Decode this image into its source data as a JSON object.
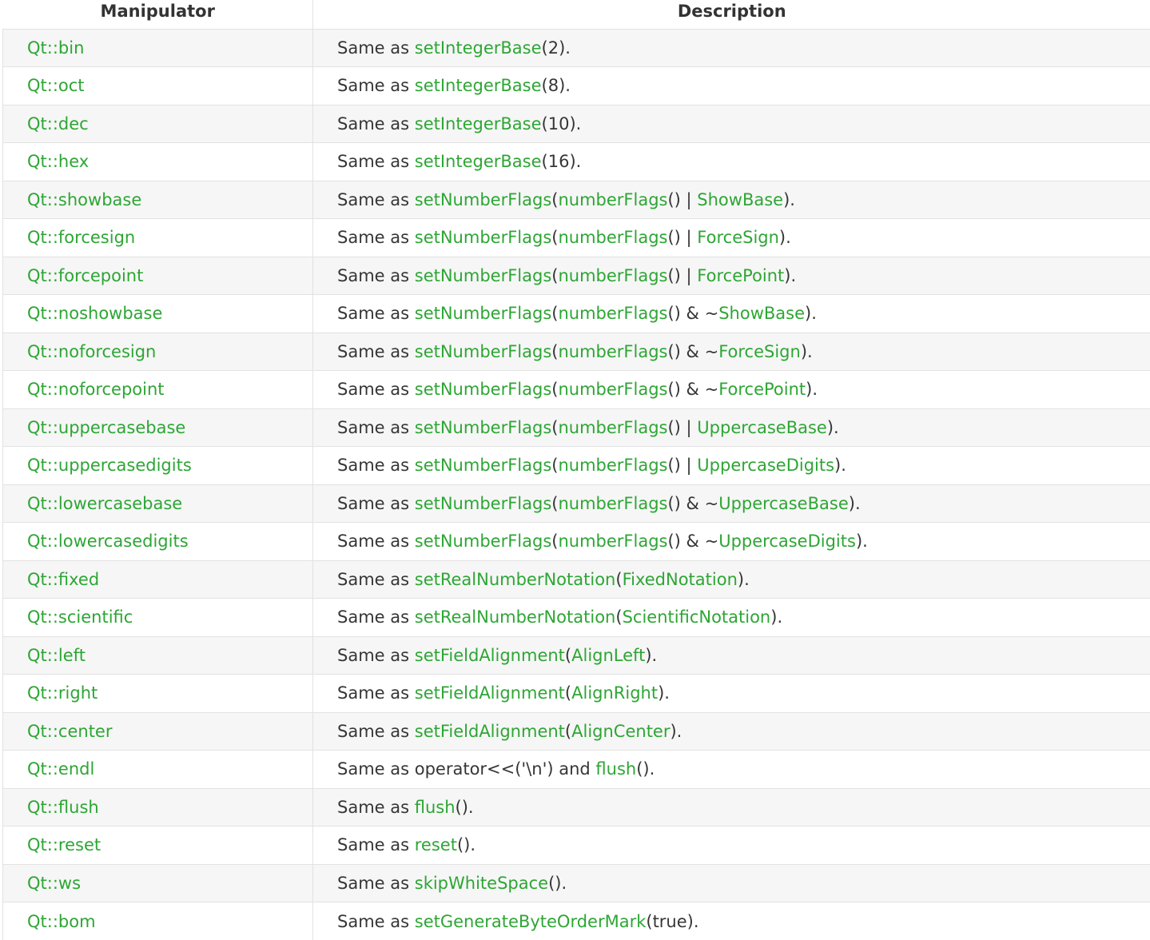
{
  "headers": {
    "col1": "Manipulator",
    "col2": "Description"
  },
  "colors": {
    "link": "#2da634",
    "text": "#363636",
    "stripe": "#f6f6f6"
  },
  "rows": [
    {
      "manipulator": "Qt::bin",
      "desc": [
        [
          "t",
          "Same as "
        ],
        [
          "l",
          "setIntegerBase"
        ],
        [
          "t",
          "(2).",
          "end"
        ]
      ]
    },
    {
      "manipulator": "Qt::oct",
      "desc": [
        [
          "t",
          "Same as "
        ],
        [
          "l",
          "setIntegerBase"
        ],
        [
          "t",
          "(8)."
        ]
      ]
    },
    {
      "manipulator": "Qt::dec",
      "desc": [
        [
          "t",
          "Same as "
        ],
        [
          "l",
          "setIntegerBase"
        ],
        [
          "t",
          "(10)."
        ]
      ]
    },
    {
      "manipulator": "Qt::hex",
      "desc": [
        [
          "t",
          "Same as "
        ],
        [
          "l",
          "setIntegerBase"
        ],
        [
          "t",
          "(16)."
        ]
      ]
    },
    {
      "manipulator": "Qt::showbase",
      "desc": [
        [
          "t",
          "Same as "
        ],
        [
          "l",
          "setNumberFlags"
        ],
        [
          "t",
          "("
        ],
        [
          "l",
          "numberFlags"
        ],
        [
          "t",
          "() | "
        ],
        [
          "l",
          "ShowBase"
        ],
        [
          "t",
          ")."
        ]
      ]
    },
    {
      "manipulator": "Qt::forcesign",
      "desc": [
        [
          "t",
          "Same as "
        ],
        [
          "l",
          "setNumberFlags"
        ],
        [
          "t",
          "("
        ],
        [
          "l",
          "numberFlags"
        ],
        [
          "t",
          "() | "
        ],
        [
          "l",
          "ForceSign"
        ],
        [
          "t",
          ")."
        ]
      ]
    },
    {
      "manipulator": "Qt::forcepoint",
      "desc": [
        [
          "t",
          "Same as "
        ],
        [
          "l",
          "setNumberFlags"
        ],
        [
          "t",
          "("
        ],
        [
          "l",
          "numberFlags"
        ],
        [
          "t",
          "() | "
        ],
        [
          "l",
          "ForcePoint"
        ],
        [
          "t",
          ")."
        ]
      ]
    },
    {
      "manipulator": "Qt::noshowbase",
      "desc": [
        [
          "t",
          "Same as "
        ],
        [
          "l",
          "setNumberFlags"
        ],
        [
          "t",
          "("
        ],
        [
          "l",
          "numberFlags"
        ],
        [
          "t",
          "() & ~"
        ],
        [
          "l",
          "ShowBase"
        ],
        [
          "t",
          ")."
        ]
      ]
    },
    {
      "manipulator": "Qt::noforcesign",
      "desc": [
        [
          "t",
          "Same as "
        ],
        [
          "l",
          "setNumberFlags"
        ],
        [
          "t",
          "("
        ],
        [
          "l",
          "numberFlags"
        ],
        [
          "t",
          "() & ~"
        ],
        [
          "l",
          "ForceSign"
        ],
        [
          "t",
          ")."
        ]
      ]
    },
    {
      "manipulator": "Qt::noforcepoint",
      "desc": [
        [
          "t",
          "Same as "
        ],
        [
          "l",
          "setNumberFlags"
        ],
        [
          "t",
          "("
        ],
        [
          "l",
          "numberFlags"
        ],
        [
          "t",
          "() & ~"
        ],
        [
          "l",
          "ForcePoint"
        ],
        [
          "t",
          ")."
        ]
      ]
    },
    {
      "manipulator": "Qt::uppercasebase",
      "desc": [
        [
          "t",
          "Same as "
        ],
        [
          "l",
          "setNumberFlags"
        ],
        [
          "t",
          "("
        ],
        [
          "l",
          "numberFlags"
        ],
        [
          "t",
          "() | "
        ],
        [
          "l",
          "UppercaseBase"
        ],
        [
          "t",
          ")."
        ]
      ]
    },
    {
      "manipulator": "Qt::uppercasedigits",
      "desc": [
        [
          "t",
          "Same as "
        ],
        [
          "l",
          "setNumberFlags"
        ],
        [
          "t",
          "("
        ],
        [
          "l",
          "numberFlags"
        ],
        [
          "t",
          "() | "
        ],
        [
          "l",
          "UppercaseDigits"
        ],
        [
          "t",
          ")."
        ]
      ]
    },
    {
      "manipulator": "Qt::lowercasebase",
      "desc": [
        [
          "t",
          "Same as "
        ],
        [
          "l",
          "setNumberFlags"
        ],
        [
          "t",
          "("
        ],
        [
          "l",
          "numberFlags"
        ],
        [
          "t",
          "() & ~"
        ],
        [
          "l",
          "UppercaseBase"
        ],
        [
          "t",
          ")."
        ]
      ]
    },
    {
      "manipulator": "Qt::lowercasedigits",
      "desc": [
        [
          "t",
          "Same as "
        ],
        [
          "l",
          "setNumberFlags"
        ],
        [
          "t",
          "("
        ],
        [
          "l",
          "numberFlags"
        ],
        [
          "t",
          "() & ~"
        ],
        [
          "l",
          "UppercaseDigits"
        ],
        [
          "t",
          ")."
        ]
      ]
    },
    {
      "manipulator": "Qt::fixed",
      "desc": [
        [
          "t",
          "Same as "
        ],
        [
          "l",
          "setRealNumberNotation"
        ],
        [
          "t",
          "("
        ],
        [
          "l",
          "FixedNotation"
        ],
        [
          "t",
          ")."
        ]
      ]
    },
    {
      "manipulator": "Qt::scientific",
      "desc": [
        [
          "t",
          "Same as "
        ],
        [
          "l",
          "setRealNumberNotation"
        ],
        [
          "t",
          "("
        ],
        [
          "l",
          "ScientificNotation"
        ],
        [
          "t",
          ")."
        ]
      ]
    },
    {
      "manipulator": "Qt::left",
      "desc": [
        [
          "t",
          "Same as "
        ],
        [
          "l",
          "setFieldAlignment"
        ],
        [
          "t",
          "("
        ],
        [
          "l",
          "AlignLeft"
        ],
        [
          "t",
          ")."
        ]
      ]
    },
    {
      "manipulator": "Qt::right",
      "desc": [
        [
          "t",
          "Same as "
        ],
        [
          "l",
          "setFieldAlignment"
        ],
        [
          "t",
          "("
        ],
        [
          "l",
          "AlignRight"
        ],
        [
          "t",
          ")."
        ]
      ]
    },
    {
      "manipulator": "Qt::center",
      "desc": [
        [
          "t",
          "Same as "
        ],
        [
          "l",
          "setFieldAlignment"
        ],
        [
          "t",
          "("
        ],
        [
          "l",
          "AlignCenter"
        ],
        [
          "t",
          ")."
        ]
      ]
    },
    {
      "manipulator": "Qt::endl",
      "desc": [
        [
          "t",
          "Same as operator<<('\\n') and "
        ],
        [
          "l",
          "flush"
        ],
        [
          "t",
          "()."
        ]
      ]
    },
    {
      "manipulator": "Qt::flush",
      "desc": [
        [
          "t",
          "Same as "
        ],
        [
          "l",
          "flush"
        ],
        [
          "t",
          "()."
        ]
      ]
    },
    {
      "manipulator": "Qt::reset",
      "desc": [
        [
          "t",
          "Same as "
        ],
        [
          "l",
          "reset"
        ],
        [
          "t",
          "()."
        ]
      ]
    },
    {
      "manipulator": "Qt::ws",
      "desc": [
        [
          "t",
          "Same as "
        ],
        [
          "l",
          "skipWhiteSpace"
        ],
        [
          "t",
          "()."
        ]
      ]
    },
    {
      "manipulator": "Qt::bom",
      "desc": [
        [
          "t",
          "Same as "
        ],
        [
          "l",
          "setGenerateByteOrderMark"
        ],
        [
          "t",
          "(true)."
        ]
      ]
    }
  ]
}
